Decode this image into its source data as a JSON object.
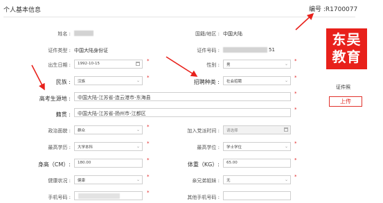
{
  "header": {
    "title": "个人基本信息",
    "serial": "编号 :R1700077"
  },
  "form": {
    "name_label": "姓名 :",
    "country_label": "国籍/地区 :",
    "country_value": "中国大陆",
    "idtype_label": "证件类型 :",
    "idtype_value": "中国大陆身份证",
    "idno_label": "证件号码 :",
    "idno_tail": "51",
    "birth_label": "出生日期 :",
    "birth_value": "1992-10-15",
    "gender_label": "性别 :",
    "gender_value": "男",
    "ethnic_label": "民族 :",
    "ethnic_value": "汉族",
    "recruit_label": "招聘种类 :",
    "recruit_value": "社会招聘",
    "gaokao_label": "高考生源地 :",
    "gaokao_value": "中国大陆-江苏省-连云港市-东海县",
    "native_label": "籍贯 :",
    "native_value": "中国大陆-江苏省-扬州市-江都区",
    "political_label": "政治面貌 :",
    "political_value": "群众",
    "party_label": "加入党派时间 :",
    "party_value": "请选择",
    "edu_label": "最高学历 :",
    "edu_value": "大学本科",
    "degree_label": "最高学位 :",
    "degree_value": "学士学位",
    "height_label": "身高（CM）:",
    "height_value": "180.00",
    "weight_label": "体重（KG）:",
    "weight_value": "65.00",
    "health_label": "健康状况 :",
    "health_value": "健康",
    "sibling_label": "亲兄弟姐妹 :",
    "sibling_value": "无",
    "phone_label": "手机号码 :",
    "other_phone_label": "其他手机号码 :"
  },
  "side": {
    "logo_line1": "东吴",
    "logo_line2": "教育",
    "photo_label": "证件照",
    "upload_label": "上传"
  },
  "colors": {
    "accent_red": "#e8211b",
    "required_star": "#e02020"
  }
}
